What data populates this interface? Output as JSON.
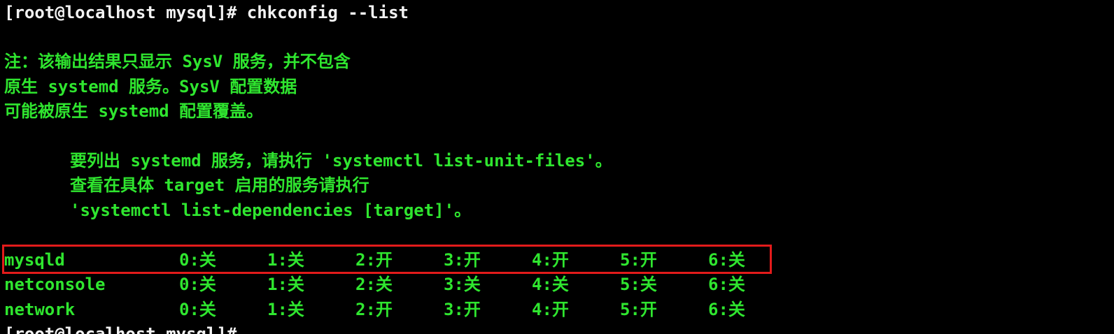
{
  "terminal": {
    "command_prompt": "[root@localhost mysql]# chkconfig --list",
    "note_lines": [
      "注：该输出结果只显示 SysV 服务，并不包含",
      "原生 systemd 服务。SysV 配置数据",
      "可能被原生 systemd 配置覆盖。"
    ],
    "hint_lines": [
      "要列出 systemd 服务，请执行 'systemctl list-unit-files'。",
      "查看在具体 target 启用的服务请执行",
      "'systemctl list-dependencies [target]'。"
    ],
    "services": [
      {
        "name": "mysqld",
        "levels": [
          "0:关",
          "1:关",
          "2:开",
          "3:开",
          "4:开",
          "5:开",
          "6:关"
        ],
        "highlighted": true
      },
      {
        "name": "netconsole",
        "levels": [
          "0:关",
          "1:关",
          "2:关",
          "3:关",
          "4:关",
          "5:关",
          "6:关"
        ],
        "highlighted": false
      },
      {
        "name": "network",
        "levels": [
          "0:关",
          "1:关",
          "2:开",
          "3:开",
          "4:开",
          "5:开",
          "6:关"
        ],
        "highlighted": false
      }
    ],
    "partial_prompt": "[root@localhost mysql]# "
  },
  "colors": {
    "background": "#000000",
    "output_text": "#2fe62f",
    "prompt_text": "#f2f2f2",
    "highlight_border": "#e31b1b"
  }
}
